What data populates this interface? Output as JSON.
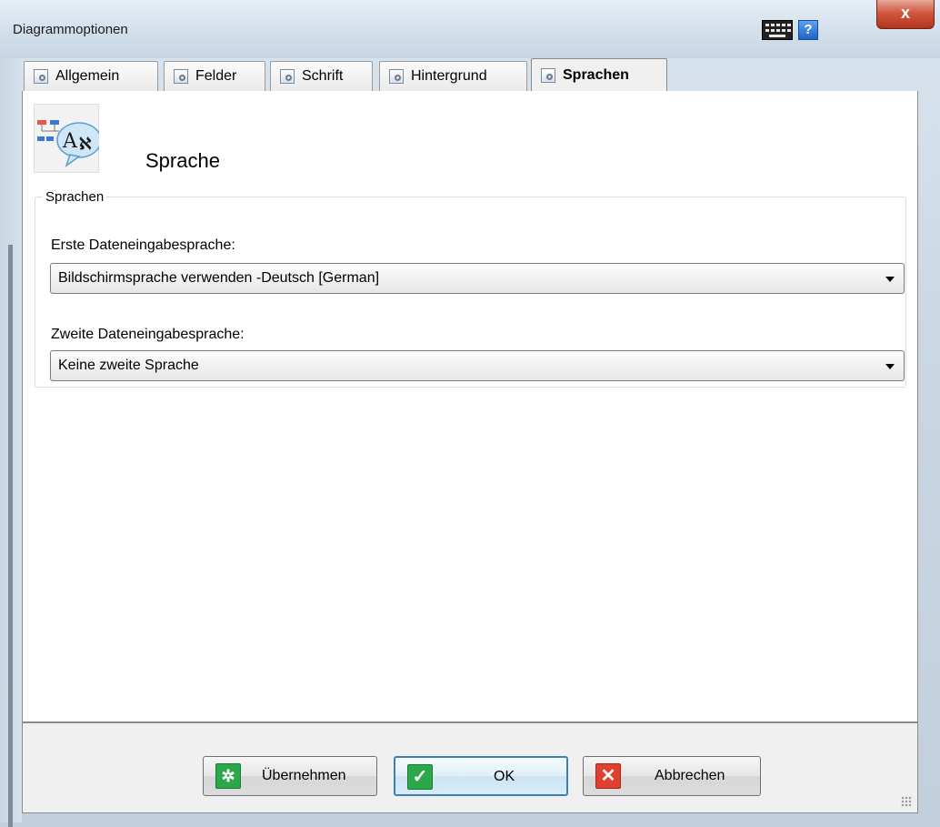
{
  "window": {
    "title": "Diagrammoptionen",
    "help_label": "?",
    "close_label": "x"
  },
  "tabs": [
    {
      "label": "Allgemein",
      "active": false
    },
    {
      "label": "Felder",
      "active": false
    },
    {
      "label": "Schrift",
      "active": false
    },
    {
      "label": "Hintergrund",
      "active": false
    },
    {
      "label": "Sprachen",
      "active": true
    }
  ],
  "page": {
    "heading": "Sprache",
    "group_title": "Sprachen",
    "first_language": {
      "label": "Erste Dateneingabesprache:",
      "value": "Bildschirmsprache verwenden -Deutsch [German]"
    },
    "second_language": {
      "label": "Zweite Dateneingabesprache:",
      "value": "Keine zweite Sprache"
    }
  },
  "buttons": {
    "apply": "Übernehmen",
    "ok": "OK",
    "cancel": "Abbrechen"
  },
  "colors": {
    "accent": "#3c7fb1",
    "apply_icon": "#2aa84a",
    "ok_icon": "#2aa84a",
    "cancel_icon": "#e0402e"
  },
  "icons": {
    "header": "language-diagram-icon",
    "tab": "settings-gear-icon",
    "apply": "apply-icon",
    "ok": "checkmark-icon",
    "cancel": "x-icon"
  }
}
